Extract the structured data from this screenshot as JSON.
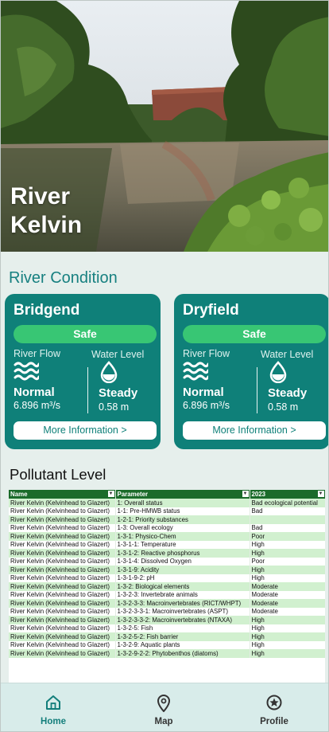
{
  "hero": {
    "title": "River Kelvin"
  },
  "section": {
    "river_condition": "River Condition",
    "pollutant_level": "Pollutant Level"
  },
  "stations": [
    {
      "name": "Bridgend",
      "status": "Safe",
      "flow_label": "River Flow",
      "level_label": "Water Level",
      "flow_state": "Normal",
      "flow_value": "6.896 m³/s",
      "level_state": "Steady",
      "level_value": "0.58 m",
      "more": "More Information >"
    },
    {
      "name": "Dryfield",
      "status": "Safe",
      "flow_label": "River Flow",
      "level_label": "Water Level",
      "flow_state": "Normal",
      "flow_value": "6.896 m³/s",
      "level_state": "Steady",
      "level_value": "0.58 m",
      "more": "More Information >"
    }
  ],
  "pollutant_table": {
    "headers": [
      "Name",
      "Parameter",
      "2023"
    ],
    "rows": [
      [
        "River Kelvin (Kelvinhead to Glazert)",
        "1: Overall status",
        "Bad ecological potential"
      ],
      [
        "River Kelvin (Kelvinhead to Glazert)",
        "1-1: Pre-HMWB status",
        "Bad"
      ],
      [
        "River Kelvin (Kelvinhead to Glazert)",
        "1-2-1: Priority substances",
        ""
      ],
      [
        "River Kelvin (Kelvinhead to Glazert)",
        "1-3: Overall ecology",
        "Bad"
      ],
      [
        "River Kelvin (Kelvinhead to Glazert)",
        "1-3-1: Physico-Chem",
        "Poor"
      ],
      [
        "River Kelvin (Kelvinhead to Glazert)",
        "1-3-1-1: Temperature",
        "High"
      ],
      [
        "River Kelvin (Kelvinhead to Glazert)",
        "1-3-1-2: Reactive phosphorus",
        "High"
      ],
      [
        "River Kelvin (Kelvinhead to Glazert)",
        "1-3-1-4: Dissolved Oxygen",
        "Poor"
      ],
      [
        "River Kelvin (Kelvinhead to Glazert)",
        "1-3-1-9: Acidity",
        "High"
      ],
      [
        "River Kelvin (Kelvinhead to Glazert)",
        "1-3-1-9-2: pH",
        "High"
      ],
      [
        "River Kelvin (Kelvinhead to Glazert)",
        "1-3-2: Biological elements",
        "Moderate"
      ],
      [
        "River Kelvin (Kelvinhead to Glazert)",
        "1-3-2-3: Invertebrate animals",
        "Moderate"
      ],
      [
        "River Kelvin (Kelvinhead to Glazert)",
        "1-3-2-3-3: Macroinvertebrates (RICT/WHPT)",
        "Moderate"
      ],
      [
        "River Kelvin (Kelvinhead to Glazert)",
        "1-3-2-3-3-1: Macroinvertebrates (ASPT)",
        "Moderate"
      ],
      [
        "River Kelvin (Kelvinhead to Glazert)",
        "1-3-2-3-3-2: Macroinvertebrates (NTAXA)",
        "High"
      ],
      [
        "River Kelvin (Kelvinhead to Glazert)",
        "1-3-2-5: Fish",
        "High"
      ],
      [
        "River Kelvin (Kelvinhead to Glazert)",
        "1-3-2-5-2: Fish barrier",
        "High"
      ],
      [
        "River Kelvin (Kelvinhead to Glazert)",
        "1-3-2-9: Aquatic plants",
        "High"
      ],
      [
        "River Kelvin (Kelvinhead to Glazert)",
        "1-3-2-9-2-2: Phytobenthos (diatoms)",
        "High"
      ]
    ]
  },
  "nav": [
    {
      "label": "Home",
      "icon": "home-icon",
      "active": true
    },
    {
      "label": "Map",
      "icon": "map-pin-icon",
      "active": false
    },
    {
      "label": "Profile",
      "icon": "profile-star-icon",
      "active": false
    }
  ],
  "colors": {
    "accent": "#0f8079",
    "safe": "#38c674",
    "table_header": "#1b6b2a",
    "row_alt": "#d1f0cf",
    "background": "#e6efec"
  }
}
